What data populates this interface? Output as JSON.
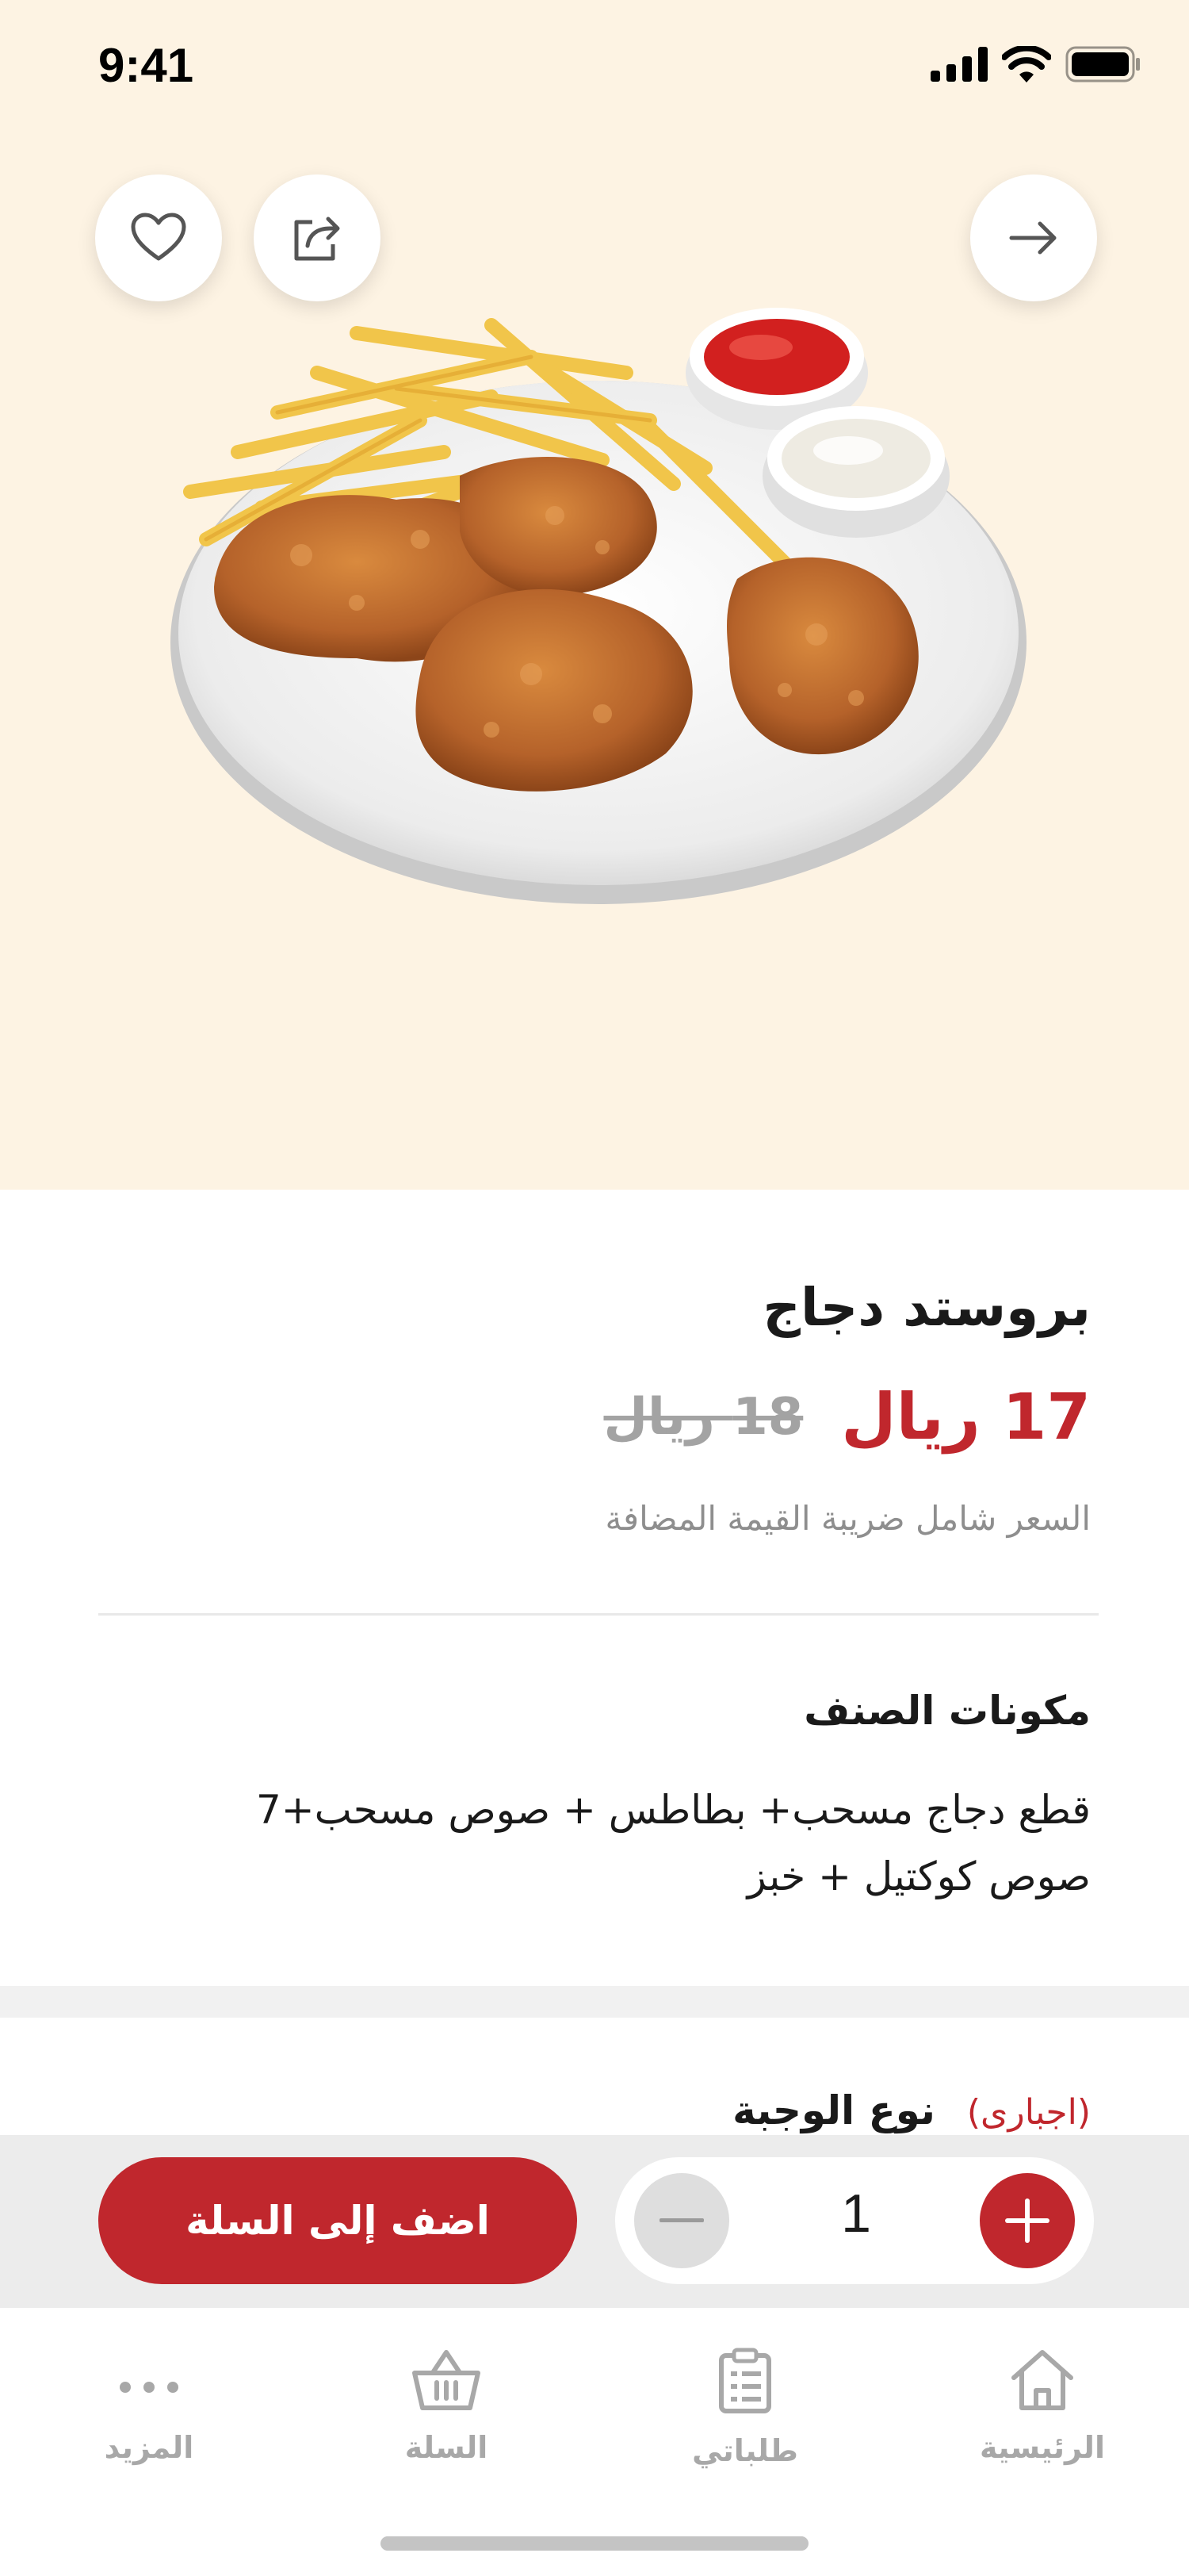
{
  "status_bar": {
    "time": "9:41"
  },
  "product": {
    "title": "بروستد دجاج",
    "price": "17 ريال",
    "old_price": "18 ريال",
    "vat_note": "السعر شامل ضريبة القيمة المضافة"
  },
  "ingredients": {
    "title": "مكونات الصنف",
    "text": "قطع دجاج مسحب+ بطاطس + صوص مسحب+7 صوص كوكتيل + خبز"
  },
  "meal_type": {
    "label": "نوع الوجبة",
    "required": "(اجبارى)"
  },
  "cart": {
    "quantity": "1",
    "add_label": "اضف إلى السلة"
  },
  "bottom_nav": {
    "items": [
      {
        "label": "الرئيسية",
        "icon": "home-icon"
      },
      {
        "label": "طلباتي",
        "icon": "orders-icon"
      },
      {
        "label": "السلة",
        "icon": "basket-icon"
      },
      {
        "label": "المزيد",
        "icon": "more-icon"
      }
    ]
  },
  "colors": {
    "accent": "#c0272d",
    "hero_background": "#fdf3e3",
    "muted": "#a8a8a8"
  }
}
